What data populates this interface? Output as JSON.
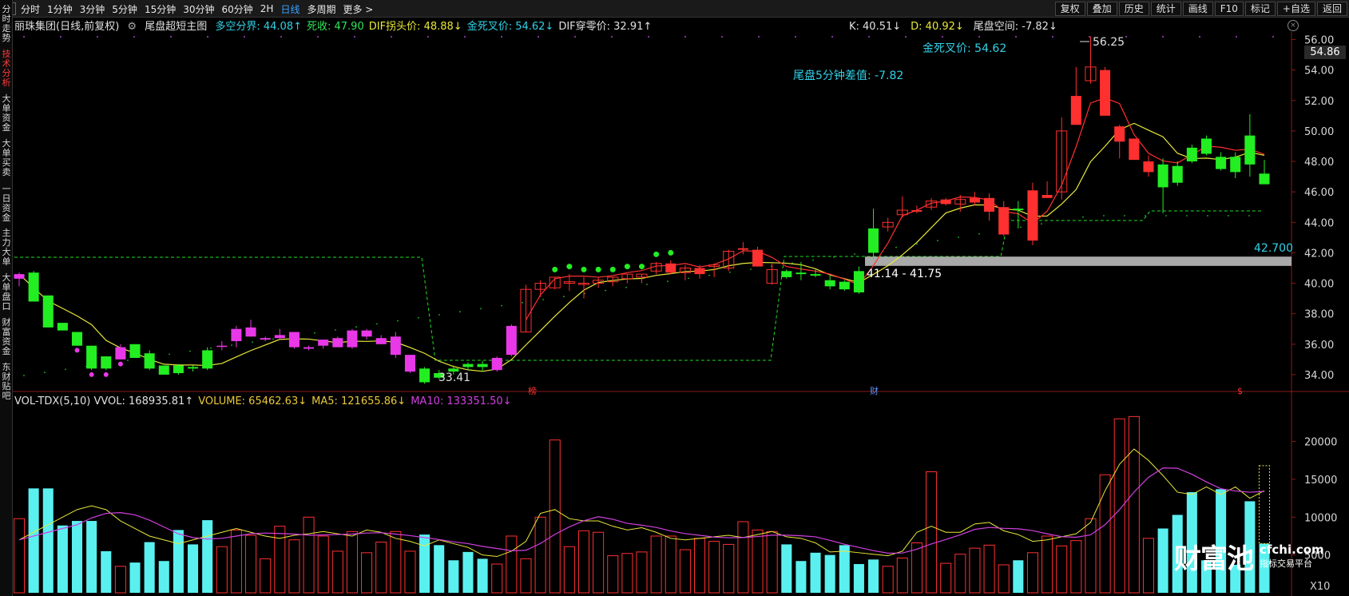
{
  "topbar": {
    "tabs": [
      {
        "label": "分时"
      },
      {
        "label": "1分钟"
      },
      {
        "label": "3分钟"
      },
      {
        "label": "5分钟"
      },
      {
        "label": "15分钟"
      },
      {
        "label": "30分钟"
      },
      {
        "label": "60分钟"
      },
      {
        "label": "2H"
      },
      {
        "label": "日线",
        "active": true
      },
      {
        "label": "多周期"
      },
      {
        "label": "更多 >"
      }
    ],
    "tools": [
      {
        "label": "复权"
      },
      {
        "label": "叠加"
      },
      {
        "label": "历史"
      },
      {
        "label": "统计"
      },
      {
        "label": "画线"
      },
      {
        "label": "F10"
      },
      {
        "label": "标记"
      },
      {
        "label": "+自选"
      },
      {
        "label": "返回"
      }
    ]
  },
  "sidebar": {
    "items": [
      {
        "label": "分时走势"
      },
      {
        "label": "技术分析",
        "active": true
      },
      {
        "label": "大单资金"
      },
      {
        "label": "大单买卖"
      },
      {
        "label": "一日资金"
      },
      {
        "label": "主力大单"
      },
      {
        "label": "大单盘口"
      },
      {
        "label": "财富资金"
      },
      {
        "label": "东财贴吧"
      }
    ]
  },
  "info": {
    "stock": "丽珠集团(日线,前复权)",
    "indicator": "尾盘超短主图",
    "items": [
      {
        "text": "多空分界: 44.08↑",
        "color": "#32d2e8"
      },
      {
        "text": "死收: 47.90",
        "color": "#2ee65a"
      },
      {
        "text": "DIF拐头价: 48.88↓",
        "color": "#e8e83a"
      },
      {
        "text": "金死叉价: 54.62↓",
        "color": "#32d2e8"
      },
      {
        "text": "DIF穿零价: 32.91↑",
        "color": "#e0e0e0"
      }
    ],
    "kd": [
      {
        "text": "K: 40.51↓",
        "color": "#e0e0e0"
      },
      {
        "text": "D: 40.92↓",
        "color": "#e8e83a"
      },
      {
        "text": "尾盘空间: -7.82↓",
        "color": "#e0e0e0"
      }
    ]
  },
  "annotations": {
    "high_label": "56.25",
    "gold_death": "金死叉价: 54.62",
    "tail_diff": "尾盘5分钟差值: -7.82",
    "low_label": "33.41",
    "range_label": "41.14 - 41.75",
    "level_label": "42.700",
    "last_price": "54.86",
    "marker_bang": "榜",
    "marker_cai": "财",
    "marker_s": "$"
  },
  "volume": {
    "items": [
      {
        "text": "VOL-TDX(5,10) VVOL: 168935.81↑",
        "color": "#e0e0e0"
      },
      {
        "text": "VOLUME: 65462.63↓",
        "color": "#e8c83a"
      },
      {
        "text": "MA5: 121655.86↓",
        "color": "#e8c83a"
      },
      {
        "text": "MA10: 133351.50↓",
        "color": "#d040e0"
      }
    ],
    "multiplier": "X10"
  },
  "watermark": {
    "big": "财富池",
    "domain": "cfchi.com",
    "tag": "指标交易平台"
  },
  "colors": {
    "up": "#ff3030",
    "down": "#22ee22",
    "magenta": "#e838e8",
    "cyan": "#5af0f0",
    "ma5": "#e8e83a",
    "ma10": "#d040e0",
    "red_line": "#ff3030"
  },
  "chart_data": {
    "type": "candlestick",
    "price_axis": {
      "ticks": [
        34,
        36,
        38,
        40,
        42,
        44,
        46,
        48,
        50,
        52,
        54,
        56
      ],
      "range": [
        33,
        56.5
      ]
    },
    "volume_axis": {
      "ticks": [
        5000,
        10000,
        15000,
        20000
      ],
      "range": [
        0,
        24500
      ]
    },
    "candles": [
      {
        "o": 40.3,
        "h": 40.7,
        "l": 39.8,
        "c": 40.6,
        "t": "m"
      },
      {
        "o": 40.7,
        "h": 40.8,
        "l": 38.8,
        "c": 38.8,
        "t": "d"
      },
      {
        "o": 39.2,
        "h": 39.2,
        "l": 37.1,
        "c": 37.1,
        "t": "d"
      },
      {
        "o": 37.4,
        "h": 37.4,
        "l": 36.9,
        "c": 36.9,
        "t": "d"
      },
      {
        "o": 36.8,
        "h": 36.8,
        "l": 35.9,
        "c": 35.9,
        "t": "d"
      },
      {
        "o": 35.9,
        "h": 35.9,
        "l": 34.3,
        "c": 34.4,
        "t": "d"
      },
      {
        "o": 35.2,
        "h": 35.2,
        "l": 34.3,
        "c": 34.4,
        "t": "d"
      },
      {
        "o": 35.0,
        "h": 36.0,
        "l": 35.0,
        "c": 35.8,
        "t": "m"
      },
      {
        "o": 36.0,
        "h": 36.0,
        "l": 35.1,
        "c": 35.1,
        "t": "d"
      },
      {
        "o": 35.4,
        "h": 35.6,
        "l": 34.3,
        "c": 34.4,
        "t": "d"
      },
      {
        "o": 34.6,
        "h": 34.6,
        "l": 34.0,
        "c": 34.0,
        "t": "d"
      },
      {
        "o": 34.6,
        "h": 34.7,
        "l": 34.0,
        "c": 34.1,
        "t": "d"
      },
      {
        "o": 34.5,
        "h": 34.6,
        "l": 34.2,
        "c": 34.4,
        "t": "d"
      },
      {
        "o": 34.4,
        "h": 35.8,
        "l": 34.3,
        "c": 35.6,
        "t": "d"
      },
      {
        "o": 35.9,
        "h": 36.2,
        "l": 35.6,
        "c": 35.9,
        "t": "m"
      },
      {
        "o": 36.2,
        "h": 37.2,
        "l": 35.8,
        "c": 37.0,
        "t": "m"
      },
      {
        "o": 37.1,
        "h": 37.6,
        "l": 36.5,
        "c": 36.5,
        "t": "m"
      },
      {
        "o": 36.4,
        "h": 36.5,
        "l": 36.2,
        "c": 36.3,
        "t": "m"
      },
      {
        "o": 36.4,
        "h": 37.0,
        "l": 36.3,
        "c": 36.6,
        "t": "m"
      },
      {
        "o": 36.8,
        "h": 36.8,
        "l": 35.7,
        "c": 35.8,
        "t": "m"
      },
      {
        "o": 35.7,
        "h": 35.9,
        "l": 35.6,
        "c": 35.8,
        "t": "m"
      },
      {
        "o": 35.9,
        "h": 36.3,
        "l": 35.7,
        "c": 36.3,
        "t": "m"
      },
      {
        "o": 36.4,
        "h": 36.5,
        "l": 35.8,
        "c": 35.8,
        "t": "m"
      },
      {
        "o": 35.8,
        "h": 37.0,
        "l": 35.7,
        "c": 36.9,
        "t": "m"
      },
      {
        "o": 36.9,
        "h": 37.0,
        "l": 36.3,
        "c": 36.5,
        "t": "m"
      },
      {
        "o": 36.4,
        "h": 36.6,
        "l": 36.0,
        "c": 36.0,
        "t": "m"
      },
      {
        "o": 36.5,
        "h": 36.8,
        "l": 35.1,
        "c": 35.3,
        "t": "m"
      },
      {
        "o": 35.3,
        "h": 35.3,
        "l": 34.1,
        "c": 34.2,
        "t": "m"
      },
      {
        "o": 34.4,
        "h": 34.5,
        "l": 33.4,
        "c": 33.5,
        "t": "d"
      },
      {
        "o": 34.1,
        "h": 34.3,
        "l": 33.7,
        "c": 33.8,
        "t": "d"
      },
      {
        "o": 34.2,
        "h": 34.6,
        "l": 34.0,
        "c": 34.4,
        "t": "d"
      },
      {
        "o": 34.5,
        "h": 34.8,
        "l": 34.3,
        "c": 34.7,
        "t": "d"
      },
      {
        "o": 34.5,
        "h": 34.9,
        "l": 34.2,
        "c": 34.7,
        "t": "d"
      },
      {
        "o": 34.3,
        "h": 35.2,
        "l": 34.2,
        "c": 35.1,
        "t": "m"
      },
      {
        "o": 35.3,
        "h": 37.3,
        "l": 35.2,
        "c": 37.2,
        "t": "m"
      },
      {
        "o": 36.8,
        "h": 39.9,
        "l": 36.8,
        "c": 39.6,
        "t": "u"
      },
      {
        "o": 39.6,
        "h": 40.2,
        "l": 39.1,
        "c": 40.0,
        "t": "u"
      },
      {
        "o": 39.7,
        "h": 40.4,
        "l": 39.6,
        "c": 40.4,
        "t": "u"
      },
      {
        "o": 40.0,
        "h": 40.6,
        "l": 39.5,
        "c": 40.1,
        "t": "u"
      },
      {
        "o": 40.0,
        "h": 40.4,
        "l": 39.0,
        "c": 40.0,
        "t": "u"
      },
      {
        "o": 40.0,
        "h": 40.4,
        "l": 39.7,
        "c": 40.2,
        "t": "u"
      },
      {
        "o": 40.1,
        "h": 40.4,
        "l": 39.8,
        "c": 40.4,
        "t": "u"
      },
      {
        "o": 40.3,
        "h": 40.6,
        "l": 40.0,
        "c": 40.6,
        "t": "u"
      },
      {
        "o": 40.4,
        "h": 40.6,
        "l": 40.0,
        "c": 40.6,
        "t": "u"
      },
      {
        "o": 40.8,
        "h": 41.4,
        "l": 40.6,
        "c": 41.3,
        "t": "u"
      },
      {
        "o": 41.3,
        "h": 41.5,
        "l": 40.6,
        "c": 40.7,
        "t": "u"
      },
      {
        "o": 40.7,
        "h": 41.2,
        "l": 40.2,
        "c": 41.0,
        "t": "u"
      },
      {
        "o": 41.0,
        "h": 41.2,
        "l": 40.3,
        "c": 40.6,
        "t": "u"
      },
      {
        "o": 41.1,
        "h": 41.3,
        "l": 40.4,
        "c": 41.2,
        "t": "u"
      },
      {
        "o": 41.0,
        "h": 42.2,
        "l": 40.8,
        "c": 42.1,
        "t": "u"
      },
      {
        "o": 42.3,
        "h": 42.7,
        "l": 41.9,
        "c": 42.2,
        "t": "u"
      },
      {
        "o": 42.2,
        "h": 42.4,
        "l": 41.1,
        "c": 41.1,
        "t": "u"
      },
      {
        "o": 40.0,
        "h": 41.3,
        "l": 39.9,
        "c": 40.9,
        "t": "u"
      },
      {
        "o": 40.8,
        "h": 40.9,
        "l": 40.3,
        "c": 40.4,
        "t": "d"
      },
      {
        "o": 40.7,
        "h": 41.4,
        "l": 40.2,
        "c": 40.6,
        "t": "d"
      },
      {
        "o": 40.6,
        "h": 40.9,
        "l": 40.4,
        "c": 40.5,
        "t": "d"
      },
      {
        "o": 40.2,
        "h": 40.5,
        "l": 39.6,
        "c": 39.8,
        "t": "d"
      },
      {
        "o": 40.1,
        "h": 40.2,
        "l": 39.5,
        "c": 39.6,
        "t": "d"
      },
      {
        "o": 40.8,
        "h": 41.1,
        "l": 39.3,
        "c": 39.4,
        "t": "d"
      },
      {
        "o": 42.0,
        "h": 44.9,
        "l": 41.5,
        "c": 43.6,
        "t": "d"
      },
      {
        "o": 43.7,
        "h": 44.3,
        "l": 43.4,
        "c": 44.0,
        "t": "u"
      },
      {
        "o": 44.5,
        "h": 45.7,
        "l": 44.3,
        "c": 44.8,
        "t": "u"
      },
      {
        "o": 44.8,
        "h": 45.1,
        "l": 44.6,
        "c": 44.7,
        "t": "u"
      },
      {
        "o": 45.0,
        "h": 45.6,
        "l": 44.8,
        "c": 45.4,
        "t": "u"
      },
      {
        "o": 45.5,
        "h": 45.6,
        "l": 45.1,
        "c": 45.2,
        "t": "u"
      },
      {
        "o": 45.2,
        "h": 45.8,
        "l": 44.7,
        "c": 45.5,
        "t": "u"
      },
      {
        "o": 45.6,
        "h": 46.0,
        "l": 45.1,
        "c": 45.3,
        "t": "u"
      },
      {
        "o": 45.6,
        "h": 45.9,
        "l": 44.1,
        "c": 44.7,
        "t": "u"
      },
      {
        "o": 45.0,
        "h": 45.4,
        "l": 43.1,
        "c": 43.2,
        "t": "u"
      },
      {
        "o": 44.8,
        "h": 45.4,
        "l": 43.6,
        "c": 44.9,
        "t": "d"
      },
      {
        "o": 46.1,
        "h": 46.6,
        "l": 42.5,
        "c": 42.8,
        "t": "u"
      },
      {
        "o": 45.8,
        "h": 46.7,
        "l": 45.6,
        "c": 45.6,
        "t": "u"
      },
      {
        "o": 46.0,
        "h": 50.9,
        "l": 45.5,
        "c": 50.0,
        "t": "u"
      },
      {
        "o": 52.3,
        "h": 54.2,
        "l": 50.4,
        "c": 50.4,
        "t": "u"
      },
      {
        "o": 53.3,
        "h": 56.2,
        "l": 53.1,
        "c": 54.2,
        "t": "u"
      },
      {
        "o": 54.0,
        "h": 54.2,
        "l": 51.0,
        "c": 51.0,
        "t": "u"
      },
      {
        "o": 50.3,
        "h": 50.4,
        "l": 48.2,
        "c": 49.3,
        "t": "u"
      },
      {
        "o": 49.5,
        "h": 49.5,
        "l": 48.1,
        "c": 48.1,
        "t": "u"
      },
      {
        "o": 48.0,
        "h": 48.4,
        "l": 47.0,
        "c": 47.3,
        "t": "u"
      },
      {
        "o": 46.3,
        "h": 48.2,
        "l": 44.6,
        "c": 47.8,
        "t": "d"
      },
      {
        "o": 46.6,
        "h": 48.0,
        "l": 46.4,
        "c": 47.7,
        "t": "d"
      },
      {
        "o": 48.0,
        "h": 49.1,
        "l": 47.9,
        "c": 48.9,
        "t": "d"
      },
      {
        "o": 48.5,
        "h": 49.7,
        "l": 48.4,
        "c": 49.5,
        "t": "d"
      },
      {
        "o": 48.3,
        "h": 48.6,
        "l": 47.4,
        "c": 47.5,
        "t": "d"
      },
      {
        "o": 47.3,
        "h": 48.6,
        "l": 46.9,
        "c": 48.3,
        "t": "d"
      },
      {
        "o": 47.8,
        "h": 51.1,
        "l": 47.0,
        "c": 49.7,
        "t": "d"
      },
      {
        "o": 47.2,
        "h": 48.1,
        "l": 46.5,
        "c": 46.5,
        "t": "d"
      }
    ],
    "volumes": [
      9800,
      13800,
      13800,
      8900,
      9500,
      9500,
      5500,
      3500,
      4000,
      6700,
      4200,
      8300,
      6400,
      9600,
      6100,
      8300,
      7600,
      4500,
      8800,
      7000,
      10000,
      7500,
      5500,
      8100,
      5300,
      6700,
      8100,
      5500,
      7700,
      6300,
      4300,
      5400,
      4500,
      3800,
      7500,
      4500,
      10000,
      20200,
      6100,
      8200,
      8000,
      4900,
      5200,
      5400,
      7500,
      7500,
      5700,
      7200,
      6800,
      6400,
      9400,
      8300,
      8100,
      6400,
      4200,
      5300,
      5000,
      6300,
      3800,
      4400,
      3500,
      4600,
      6600,
      16000,
      3900,
      5100,
      5900,
      6300,
      3700,
      4300,
      5300,
      7500,
      6200,
      6900,
      9800,
      15600,
      23000,
      23300,
      7200,
      8500,
      10300,
      13300,
      4300,
      13700,
      3700,
      12100,
      6500
    ],
    "ma5": [
      7000,
      8000,
      9000,
      10000,
      11000,
      11500,
      11000,
      9500,
      8500,
      7500,
      7000,
      6500,
      7000,
      7500,
      8000,
      8500,
      8000,
      7500,
      7200,
      7600,
      7800,
      8100,
      7800,
      7500,
      8300,
      8000,
      7200,
      6800,
      6200,
      7000,
      6500,
      6000,
      5000,
      4800,
      5500,
      6800,
      10500,
      11000,
      9800,
      9500,
      9500,
      8800,
      8300,
      8600,
      8000,
      7200,
      7000,
      7200,
      7400,
      7600,
      7300,
      7700,
      8100,
      7400,
      7200,
      6600,
      5400,
      5500,
      5300,
      5100,
      4900,
      5500,
      8000,
      8800,
      8000,
      8000,
      9100,
      9300,
      8200,
      7700,
      6800,
      7000,
      7400,
      7800,
      9300,
      13500,
      17000,
      19000,
      17500,
      15500,
      13300,
      13000,
      14000,
      13000,
      14000,
      12500,
      13500
    ]
  }
}
